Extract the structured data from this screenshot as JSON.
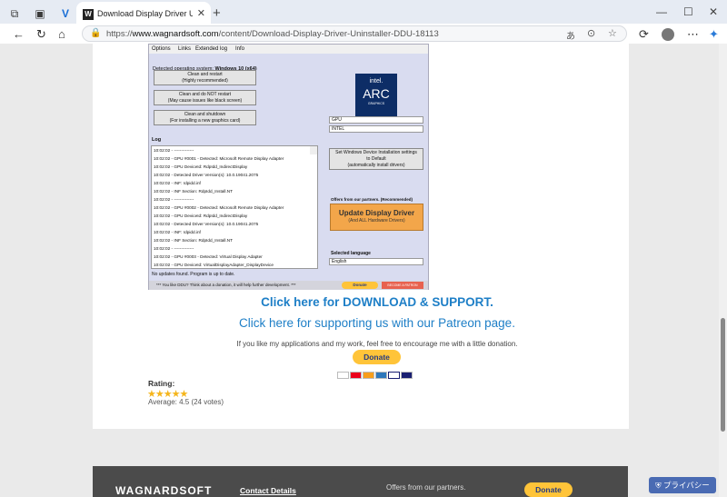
{
  "browser": {
    "tab_title": "Download Display Driver Uninstall",
    "tab_favicon": "W",
    "url_prefix": "https://",
    "url_domain": "www.wagnardsoft.com",
    "url_path": "/content/Download-Display-Driver-Uninstaller-DDU-18113",
    "reader_label": "あ"
  },
  "app": {
    "menu": [
      "Options",
      "Links",
      "Extended log",
      "Info"
    ],
    "detected_os_label": "Detected operating system:",
    "detected_os_value": "Windows 10 (x64)",
    "btn_restart": [
      "Clean and restart",
      "(Highly recommended)"
    ],
    "btn_norestart": [
      "Clean and do NOT restart",
      "(May cause issues like black screen)"
    ],
    "btn_shutdown": [
      "Clean and shutdown",
      "(For installing a new graphics card)"
    ],
    "logo_brand": "intel.",
    "logo_product": "ARC",
    "logo_sub": "GRAPHICS",
    "device_type": "GPU",
    "vendor": "INTEL",
    "set_windows": [
      "Set Windows Device Installation settings",
      "to Default",
      "(automatically install drivers)"
    ],
    "log_label": "Log",
    "log_lines": [
      "10:02:02 - --------------",
      "10:02:02 - GPU #0001 - Detected: Microsoft Remote Display Adapter",
      "10:02:02 - GPU DeviceId: RdpIdd_IndirectDisplay",
      "10:02:02 - Detected Driver Version(s): 10.0.19041.2075",
      "10:02:02 - INF: rdpidd.inf",
      "10:02:02 - INF Section: RdpIdd_Install.NT",
      "10:02:02 - --------------",
      "10:02:02 - GPU #0002 - Detected: Microsoft Remote Display Adapter",
      "10:02:02 - GPU DeviceId: RdpIdd_IndirectDisplay",
      "10:02:02 - Detected Driver Version(s): 10.0.19041.2075",
      "10:02:02 - INF: rdpidd.inf",
      "10:02:02 - INF Section: RdpIdd_Install.NT",
      "10:02:02 - --------------",
      "10:02:02 - GPU #0003 - Detected: Virtual Display Adapter",
      "10:02:02 - GPU DeviceId: VirtualDisplayAdapter_DisplayDevice"
    ],
    "no_updates": "No updates found. Program is up to date.",
    "offers_label": "Offers from our partners. (Recommended)",
    "update_title": "Update Display Driver",
    "update_sub": "(And ALL Hardware Drivers)",
    "selected_language_label": "Selected language",
    "language": "English",
    "donation_bar": "*** You like DDU? Think about a donation, it will help further development. ***",
    "donate_small": "Donate",
    "patreon_small": "BECOME A PATRON"
  },
  "page": {
    "download_link": "Click here for DOWNLOAD & SUPPORT.",
    "patreon_link": "Click here for supporting us with our Patreon page.",
    "like_text": "If you like my applications and my work, feel free to encourage me with a little donation.",
    "donate_label": "Donate",
    "cards": [
      "VISA",
      "MC",
      "AMEX",
      "BANK",
      "VISA"
    ],
    "rating_label": "Rating:",
    "stars": "★★★★★",
    "average": "Average: 4.5 (24 votes)"
  },
  "footer": {
    "logo": "WAGNARDSOFT",
    "contact": "Contact Details",
    "offers": "Offers from our partners.",
    "donate_label": "Donate"
  },
  "privacy_label": "プライバシー"
}
